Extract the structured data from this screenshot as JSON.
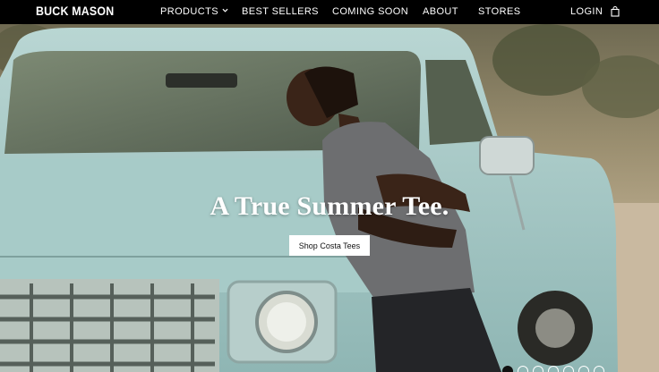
{
  "brand": {
    "logo_text": "BUCK MASON"
  },
  "nav": {
    "items": [
      {
        "label": "PRODUCTS",
        "has_dropdown": true
      },
      {
        "label": "BEST SELLERS"
      },
      {
        "label": "COMING SOON"
      },
      {
        "label": "ABOUT"
      },
      {
        "label": "STORES"
      }
    ],
    "login_label": "LOGIN",
    "cart_icon": "shopping-bag-icon"
  },
  "hero": {
    "headline": "A True Summer Tee.",
    "cta_label": "Shop Costa Tees",
    "slide_count": 7,
    "active_slide": 1
  },
  "colors": {
    "nav_bg": "#000000",
    "nav_text": "#ffffff",
    "truck_body": "#a9cdcb",
    "cta_bg": "#ffffff"
  }
}
